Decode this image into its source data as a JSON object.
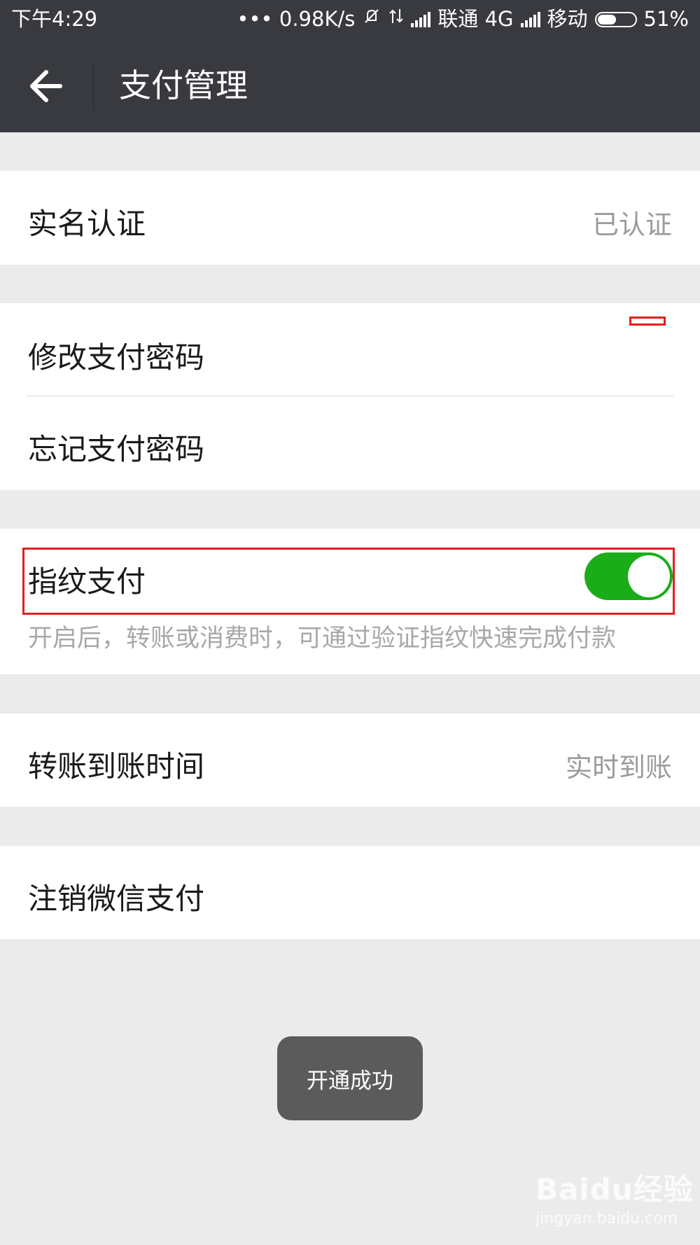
{
  "status_bar": {
    "time": "下午4:29",
    "indicators": "••• 0.98K/s",
    "carrier1": "联通 4G",
    "carrier2": "移动",
    "battery": "51%",
    "battery_level": 0.51
  },
  "app_bar": {
    "back_icon": "arrow-left-icon",
    "title": "支付管理"
  },
  "sections": {
    "real_name": {
      "label": "实名认证",
      "value": "已认证"
    },
    "change_password": {
      "label": "修改支付密码"
    },
    "forgot_password": {
      "label": "忘记支付密码"
    },
    "fingerprint": {
      "label": "指纹支付",
      "enabled": true,
      "hint": "开启后，转账或消费时，可通过验证指纹快速完成付款"
    },
    "transfer_time": {
      "label": "转账到账时间",
      "value": "实时到账"
    },
    "cancel_wechat_pay": {
      "label": "注销微信支付"
    }
  },
  "toast": {
    "text": "开通成功"
  },
  "watermark": {
    "brand": "Baidu经验",
    "url": "jingyan.baidu.com"
  },
  "colors": {
    "header_bg": "#393a3f",
    "toggle_on": "#1aad19",
    "page_bg": "#ebebeb",
    "annotation": "#e02020"
  }
}
